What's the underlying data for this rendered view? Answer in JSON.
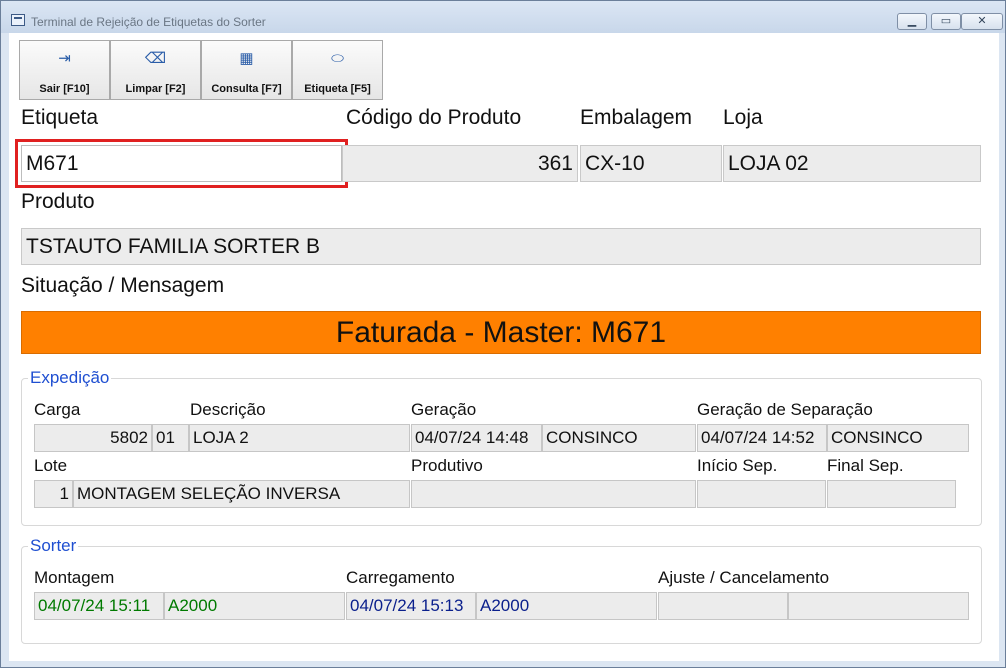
{
  "window": {
    "title": "Terminal de Rejeição de Etiquetas do Sorter",
    "controls": {
      "minimize": "▁",
      "maximize": "▭",
      "close": "✕"
    }
  },
  "toolbar": {
    "buttons": [
      {
        "label": "Sair [F10]",
        "icon": "exit-icon",
        "glyph": "⇥"
      },
      {
        "label": "Limpar [F2]",
        "icon": "eraser-icon",
        "glyph": "⌫"
      },
      {
        "label": "Consulta [F7]",
        "icon": "table-icon",
        "glyph": "▦"
      },
      {
        "label": "Etiqueta [F5]",
        "icon": "tag-icon",
        "glyph": "⬭"
      }
    ]
  },
  "labels": {
    "etiqueta": "Etiqueta",
    "codigo_produto": "Código do Produto",
    "embalagem": "Embalagem",
    "loja": "Loja",
    "produto": "Produto",
    "situacao": "Situação / Mensagem"
  },
  "values": {
    "etiqueta": "M671",
    "codigo_produto": "361",
    "embalagem": "CX-10",
    "loja": "LOJA 02",
    "produto": "TSTAUTO FAMILIA SORTER B",
    "mensagem": "Faturada - Master: M671"
  },
  "expedicao": {
    "title": "Expedição",
    "labels": {
      "carga": "Carga",
      "descricao": "Descrição",
      "geracao": "Geração",
      "geracao_separacao": "Geração de Separação",
      "lote": "Lote",
      "produtivo": "Produtivo",
      "inicio_sep": "Início Sep.",
      "final_sep": "Final Sep."
    },
    "values": {
      "carga": "5802",
      "carga_seq": "01",
      "descricao": "LOJA 2",
      "geracao_data": "04/07/24 14:48",
      "geracao_usuario": "CONSINCO",
      "geracao_sep_data": "04/07/24 14:52",
      "geracao_sep_usuario": "CONSINCO",
      "lote": "1",
      "lote_desc": "MONTAGEM SELEÇÃO INVERSA",
      "produtivo": "",
      "inicio_sep": "",
      "final_sep": ""
    }
  },
  "sorter": {
    "title": "Sorter",
    "labels": {
      "montagem": "Montagem",
      "carregamento": "Carregamento",
      "ajuste": "Ajuste / Cancelamento"
    },
    "values": {
      "montagem_data": "04/07/24 15:11",
      "montagem_local": "A2000",
      "carregamento_data": "04/07/24 15:13",
      "carregamento_local": "A2000",
      "ajuste_data": "",
      "ajuste_local": ""
    }
  },
  "colors": {
    "banner": "#ff8000",
    "highlight": "#e02020",
    "group_title": "#1f4fd1",
    "montagem_text": "#007a00",
    "carregamento_text": "#0a1f8c"
  }
}
